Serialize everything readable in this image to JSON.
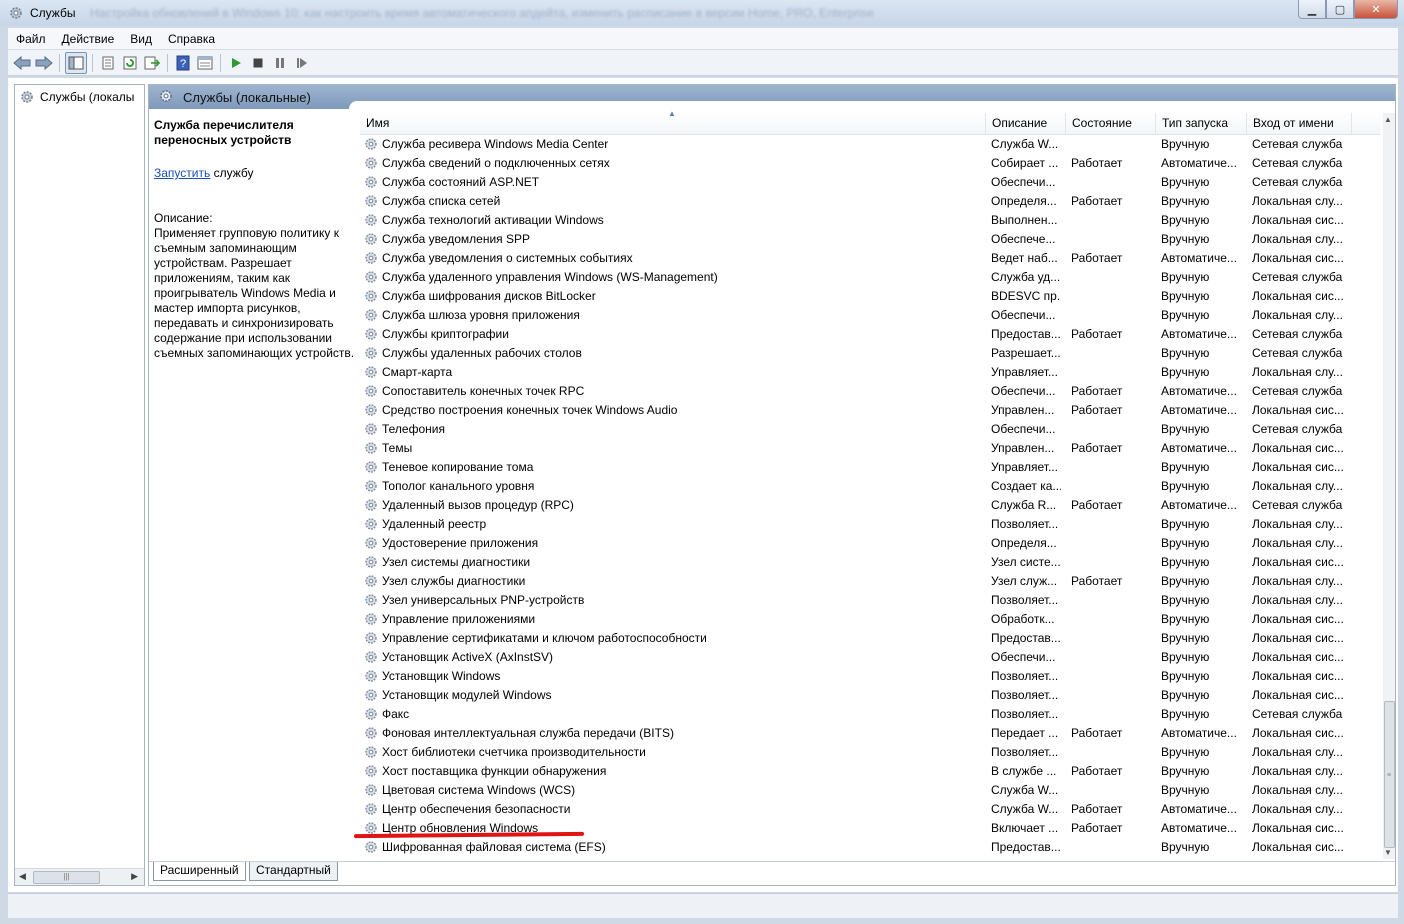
{
  "window": {
    "title": "Службы",
    "blurred_title": "Настройка обновлений в Windows 10: как настроить время автоматического апдейта, изменить расписание в версии Home, PRO, Enterprise"
  },
  "menu": [
    "Файл",
    "Действие",
    "Вид",
    "Справка"
  ],
  "toolbar": {
    "icons": [
      "back-icon",
      "forward-icon",
      "show-hide-tree-icon",
      "properties-icon",
      "refresh-icon",
      "export-icon",
      "help-icon",
      "view-icon",
      "start-service-icon",
      "stop-service-icon",
      "pause-service-icon",
      "restart-service-icon"
    ]
  },
  "tree": {
    "root_label": "Службы (локалы"
  },
  "header": {
    "title": "Службы (локальные)"
  },
  "description_panel": {
    "title": "Служба перечислителя переносных устройств",
    "action_link": "Запустить",
    "action_suffix": " службу",
    "desc_label": "Описание:",
    "desc_text": "Применяет групповую политику к съемным запоминающим устройствам. Разрешает приложениям, таким как проигрыватель Windows Media и мастер импорта рисунков, передавать и синхронизировать содержание при использовании съемных запоминающих устройств."
  },
  "columns": {
    "name": "Имя",
    "description": "Описание",
    "state": "Состояние",
    "startup": "Тип запуска",
    "logon": "Вход от имени"
  },
  "rows": [
    {
      "name": "Служба ресивера Windows Media Center",
      "desc": "Служба W...",
      "state": "",
      "start": "Вручную",
      "logon": "Сетевая служба"
    },
    {
      "name": "Служба сведений о подключенных сетях",
      "desc": "Собирает ...",
      "state": "Работает",
      "start": "Автоматиче...",
      "logon": "Сетевая служба"
    },
    {
      "name": "Служба состояний ASP.NET",
      "desc": "Обеспечи...",
      "state": "",
      "start": "Вручную",
      "logon": "Сетевая служба"
    },
    {
      "name": "Служба списка сетей",
      "desc": "Определя...",
      "state": "Работает",
      "start": "Вручную",
      "logon": "Локальная слу..."
    },
    {
      "name": "Служба технологий активации Windows",
      "desc": "Выполнен...",
      "state": "",
      "start": "Вручную",
      "logon": "Локальная сис..."
    },
    {
      "name": "Служба уведомления SPP",
      "desc": "Обеспече...",
      "state": "",
      "start": "Вручную",
      "logon": "Локальная слу..."
    },
    {
      "name": "Служба уведомления о системных событиях",
      "desc": "Ведет наб...",
      "state": "Работает",
      "start": "Автоматиче...",
      "logon": "Локальная сис..."
    },
    {
      "name": "Служба удаленного управления Windows (WS-Management)",
      "desc": "Служба уд...",
      "state": "",
      "start": "Вручную",
      "logon": "Сетевая служба"
    },
    {
      "name": "Служба шифрования дисков BitLocker",
      "desc": "BDESVC пр...",
      "state": "",
      "start": "Вручную",
      "logon": "Локальная сис..."
    },
    {
      "name": "Служба шлюза уровня приложения",
      "desc": "Обеспечи...",
      "state": "",
      "start": "Вручную",
      "logon": "Локальная слу..."
    },
    {
      "name": "Службы криптографии",
      "desc": "Предостав...",
      "state": "Работает",
      "start": "Автоматиче...",
      "logon": "Сетевая служба"
    },
    {
      "name": "Службы удаленных рабочих столов",
      "desc": "Разрешает...",
      "state": "",
      "start": "Вручную",
      "logon": "Сетевая служба"
    },
    {
      "name": "Смарт-карта",
      "desc": "Управляет...",
      "state": "",
      "start": "Вручную",
      "logon": "Локальная слу..."
    },
    {
      "name": "Сопоставитель конечных точек RPC",
      "desc": "Обеспечи...",
      "state": "Работает",
      "start": "Автоматиче...",
      "logon": "Сетевая служба"
    },
    {
      "name": "Средство построения конечных точек Windows Audio",
      "desc": "Управлен...",
      "state": "Работает",
      "start": "Автоматиче...",
      "logon": "Локальная сис..."
    },
    {
      "name": "Телефония",
      "desc": "Обеспечи...",
      "state": "",
      "start": "Вручную",
      "logon": "Сетевая служба"
    },
    {
      "name": "Темы",
      "desc": "Управлен...",
      "state": "Работает",
      "start": "Автоматиче...",
      "logon": "Локальная сис..."
    },
    {
      "name": "Теневое копирование тома",
      "desc": "Управляет...",
      "state": "",
      "start": "Вручную",
      "logon": "Локальная сис..."
    },
    {
      "name": "Тополог канального уровня",
      "desc": "Создает ка...",
      "state": "",
      "start": "Вручную",
      "logon": "Локальная слу..."
    },
    {
      "name": "Удаленный вызов процедур (RPC)",
      "desc": "Служба R...",
      "state": "Работает",
      "start": "Автоматиче...",
      "logon": "Сетевая служба"
    },
    {
      "name": "Удаленный реестр",
      "desc": "Позволяет...",
      "state": "",
      "start": "Вручную",
      "logon": "Локальная слу..."
    },
    {
      "name": "Удостоверение приложения",
      "desc": "Определя...",
      "state": "",
      "start": "Вручную",
      "logon": "Локальная слу..."
    },
    {
      "name": "Узел системы диагностики",
      "desc": "Узел систе...",
      "state": "",
      "start": "Вручную",
      "logon": "Локальная сис..."
    },
    {
      "name": "Узел службы диагностики",
      "desc": "Узел служ...",
      "state": "Работает",
      "start": "Вручную",
      "logon": "Локальная слу..."
    },
    {
      "name": "Узел универсальных PNP-устройств",
      "desc": "Позволяет...",
      "state": "",
      "start": "Вручную",
      "logon": "Локальная слу..."
    },
    {
      "name": "Управление приложениями",
      "desc": "Обработк...",
      "state": "",
      "start": "Вручную",
      "logon": "Локальная сис..."
    },
    {
      "name": "Управление сертификатами и ключом работоспособности",
      "desc": "Предостав...",
      "state": "",
      "start": "Вручную",
      "logon": "Локальная сис..."
    },
    {
      "name": "Установщик ActiveX (AxInstSV)",
      "desc": "Обеспечи...",
      "state": "",
      "start": "Вручную",
      "logon": "Локальная сис..."
    },
    {
      "name": "Установщик Windows",
      "desc": "Позволяет...",
      "state": "",
      "start": "Вручную",
      "logon": "Локальная сис..."
    },
    {
      "name": "Установщик модулей Windows",
      "desc": "Позволяет...",
      "state": "",
      "start": "Вручную",
      "logon": "Локальная сис..."
    },
    {
      "name": "Факс",
      "desc": "Позволяет...",
      "state": "",
      "start": "Вручную",
      "logon": "Сетевая служба"
    },
    {
      "name": "Фоновая интеллектуальная служба передачи (BITS)",
      "desc": "Передает ...",
      "state": "Работает",
      "start": "Автоматиче...",
      "logon": "Локальная сис..."
    },
    {
      "name": "Хост библиотеки счетчика производительности",
      "desc": "Позволяет...",
      "state": "",
      "start": "Вручную",
      "logon": "Локальная слу..."
    },
    {
      "name": "Хост поставщика функции обнаружения",
      "desc": "В службе ...",
      "state": "Работает",
      "start": "Вручную",
      "logon": "Локальная слу..."
    },
    {
      "name": "Цветовая система Windows (WCS)",
      "desc": "Служба W...",
      "state": "",
      "start": "Вручную",
      "logon": "Локальная слу..."
    },
    {
      "name": "Центр обеспечения безопасности",
      "desc": "Служба W...",
      "state": "Работает",
      "start": "Автоматиче...",
      "logon": "Локальная слу..."
    },
    {
      "name": "Центр обновления Windows",
      "desc": "Включает ...",
      "state": "Работает",
      "start": "Автоматиче...",
      "logon": "Локальная сис...",
      "highlight": true
    },
    {
      "name": "Шифрованная файловая система (EFS)",
      "desc": "Предостав...",
      "state": "",
      "start": "Вручную",
      "logon": "Локальная сис..."
    }
  ],
  "tabs": [
    "Расширенный",
    "Стандартный"
  ],
  "colors": {
    "highlight_underline": "#e11414",
    "link": "#1a4fb5",
    "header_band": "#8fa8c6"
  }
}
